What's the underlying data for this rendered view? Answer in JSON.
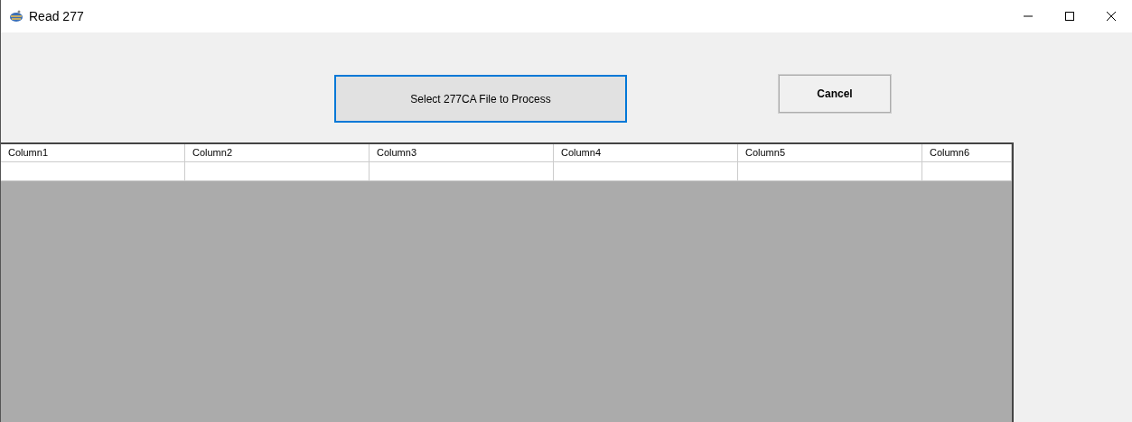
{
  "window": {
    "title": "Read 277"
  },
  "buttons": [
    {
      "label": "Select 277CA  File to Process",
      "focused": true
    },
    {
      "label": "Cancel",
      "focused": false
    }
  ],
  "grid": {
    "columns": [
      "Column1",
      "Column2",
      "Column3",
      "Column4",
      "Column5",
      "Column6"
    ]
  }
}
